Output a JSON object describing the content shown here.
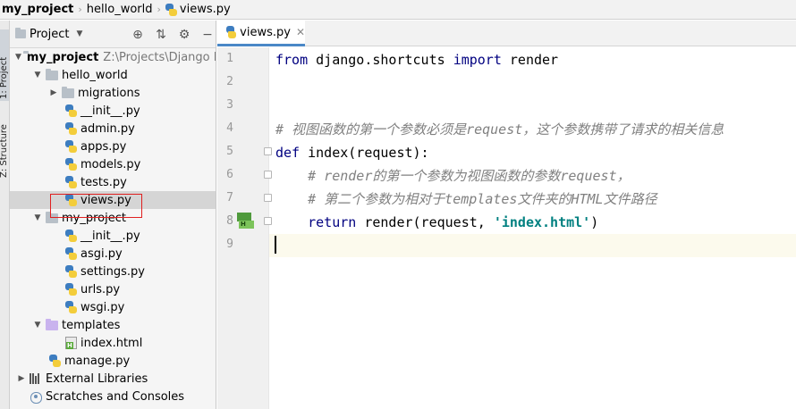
{
  "breadcrumb": {
    "project": "my_project",
    "folder": "hello_world",
    "file": "views.py"
  },
  "sidebar_tabs": {
    "project": "1: Project",
    "structure": "Z: Structure"
  },
  "project_panel": {
    "title": "Project",
    "header_icons": [
      "target-icon",
      "collapse-all-icon",
      "gear-icon",
      "hide-icon"
    ],
    "tree": [
      {
        "label": "my_project",
        "path": "Z:\\Projects\\Django P",
        "type": "root-folder",
        "expanded": true
      },
      {
        "label": "hello_world",
        "type": "folder",
        "expanded": true
      },
      {
        "label": "migrations",
        "type": "folder",
        "expanded": false
      },
      {
        "label": "__init__.py",
        "type": "python"
      },
      {
        "label": "admin.py",
        "type": "python"
      },
      {
        "label": "apps.py",
        "type": "python"
      },
      {
        "label": "models.py",
        "type": "python"
      },
      {
        "label": "tests.py",
        "type": "python"
      },
      {
        "label": "views.py",
        "type": "python",
        "selected": true
      },
      {
        "label": "my_project",
        "type": "folder",
        "expanded": true
      },
      {
        "label": "__init__.py",
        "type": "python"
      },
      {
        "label": "asgi.py",
        "type": "python"
      },
      {
        "label": "settings.py",
        "type": "python"
      },
      {
        "label": "urls.py",
        "type": "python"
      },
      {
        "label": "wsgi.py",
        "type": "python"
      },
      {
        "label": "templates",
        "type": "template-folder",
        "expanded": true
      },
      {
        "label": "index.html",
        "type": "html"
      },
      {
        "label": "manage.py",
        "type": "python"
      },
      {
        "label": "External Libraries",
        "type": "libraries",
        "expanded": false
      },
      {
        "label": "Scratches and Consoles",
        "type": "scratches"
      }
    ]
  },
  "editor": {
    "tab_label": "views.py",
    "line_numbers": [
      "1",
      "2",
      "3",
      "4",
      "5",
      "6",
      "7",
      "8",
      "9"
    ],
    "code": {
      "l1_from": "from",
      "l1_module": " django.shortcuts ",
      "l1_import": "import",
      "l1_name": " render",
      "l4": "# 视图函数的第一个参数必须是request，这个参数携带了请求的相关信息",
      "l5_def": "def",
      "l5_rest": " index(request):",
      "l6": "    # render的第一个参数为视图函数的参数request，",
      "l7": "    # 第二个参数为相对于templates文件夹的HTML文件路径",
      "l8_return": "    return",
      "l8_mid": " render(request, ",
      "l8_str": "'index.html'",
      "l8_end": ")"
    }
  },
  "colors": {
    "keyword": "#000080",
    "comment": "#808080",
    "string": "#008080",
    "selection_box": "#e02020",
    "tab_underline": "#4a88c7"
  }
}
